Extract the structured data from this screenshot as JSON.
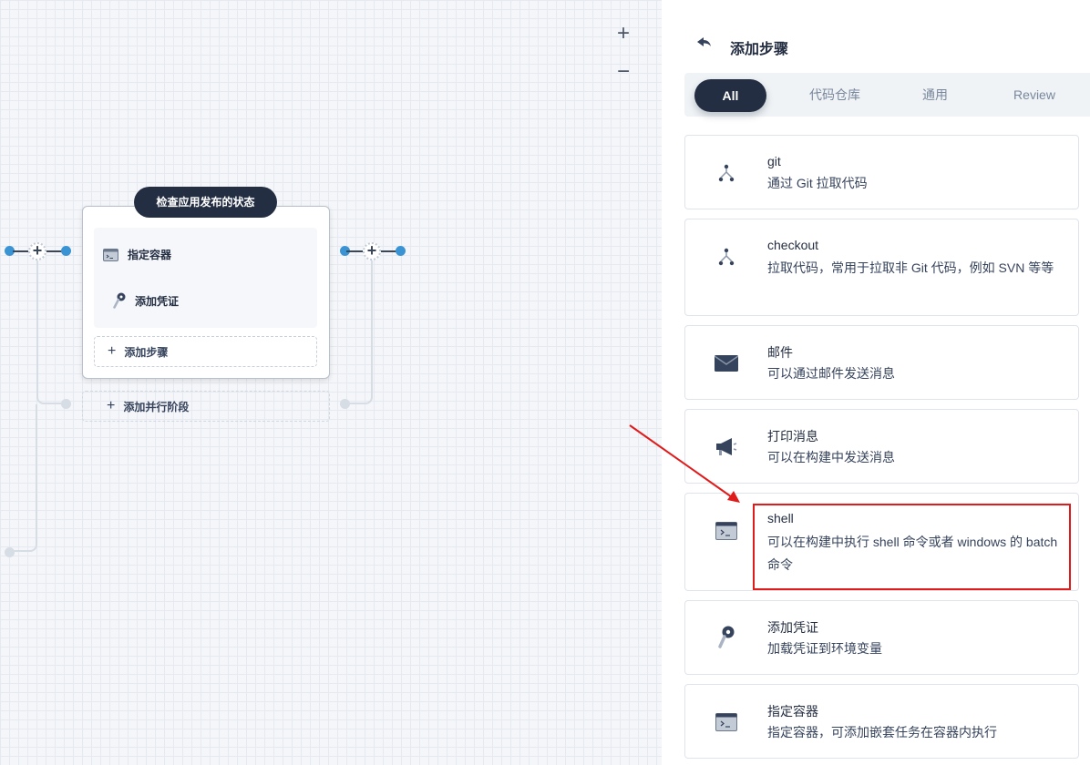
{
  "canvas": {
    "zoom_in_label": "+",
    "zoom_out_label": "−",
    "stage": {
      "title": "检查应用发布的状态",
      "steps": [
        {
          "label": "指定容器",
          "icon": "terminal-icon"
        },
        {
          "label": "添加凭证",
          "icon": "key-icon"
        }
      ],
      "add_step_label": "添加步骤",
      "add_parallel_label": "添加并行阶段"
    }
  },
  "panel": {
    "title": "添加步骤",
    "tabs": [
      {
        "label": "All",
        "active": true
      },
      {
        "label": "代码仓库",
        "active": false
      },
      {
        "label": "通用",
        "active": false
      },
      {
        "label": "Review",
        "active": false
      }
    ],
    "cards": [
      {
        "name": "git",
        "desc": "通过 Git 拉取代码",
        "icon": "git-branch-icon"
      },
      {
        "name": "checkout",
        "desc": "拉取代码，常用于拉取非 Git 代码，例如 SVN 等等",
        "icon": "git-branch-icon"
      },
      {
        "name": "邮件",
        "desc": "可以通过邮件发送消息",
        "icon": "mail-icon"
      },
      {
        "name": "打印消息",
        "desc": "可以在构建中发送消息",
        "icon": "megaphone-icon"
      },
      {
        "name": "shell",
        "desc": "可以在构建中执行 shell 命令或者 windows 的 batch 命令",
        "icon": "terminal-icon"
      },
      {
        "name": "添加凭证",
        "desc": "加载凭证到环境变量",
        "icon": "key-icon"
      },
      {
        "name": "指定容器",
        "desc": "指定容器，可添加嵌套任务在容器内执行",
        "icon": "terminal-icon"
      }
    ]
  },
  "colors": {
    "dark": "#242e42",
    "accent_blue": "#3a94d4",
    "annotation_red": "#e01b1b"
  }
}
